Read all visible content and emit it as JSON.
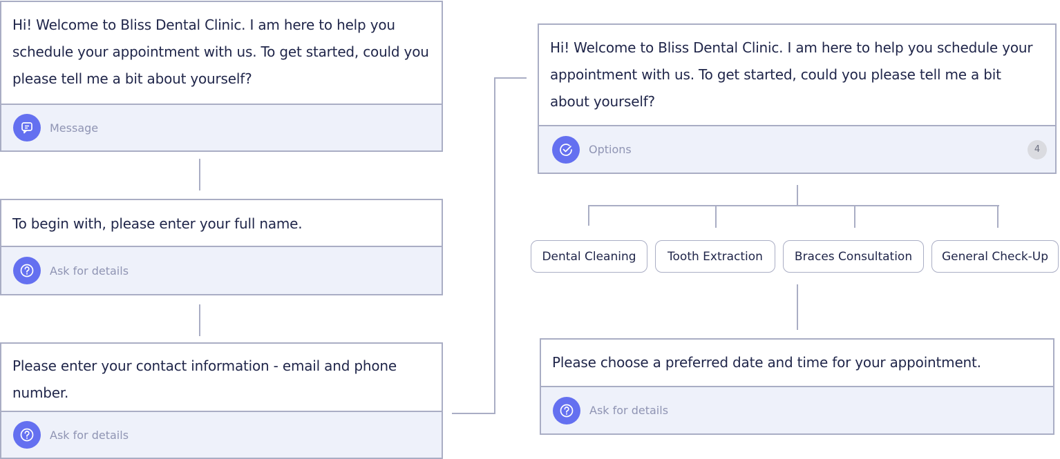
{
  "nodes": {
    "welcome_left": {
      "text": "Hi! Welcome to Bliss Dental Clinic. I am here to help you schedule your appointment with us. To get started, could you please tell me a bit about yourself?",
      "footer_label": "Message"
    },
    "full_name": {
      "text": "To begin with, please enter your full name.",
      "footer_label": "Ask for details"
    },
    "contact": {
      "text": "Please enter your contact information - email and phone number.",
      "footer_label": "Ask for details"
    },
    "welcome_right": {
      "text": "Hi! Welcome to Bliss Dental Clinic. I am here to help you schedule your appointment with us. To get started, could you please tell me a bit about yourself?",
      "footer_label": "Options",
      "count": "4"
    },
    "date_time": {
      "text": "Please choose a preferred date and time for your appointment.",
      "footer_label": "Ask for details"
    }
  },
  "options": [
    {
      "label": "Dental Cleaning"
    },
    {
      "label": "Tooth Extraction"
    },
    {
      "label": "Braces Consultation"
    },
    {
      "label": "General Check-Up"
    }
  ],
  "icons": {
    "message": "chat-bubble-icon",
    "ask_for_details": "question-circle-icon",
    "options": "check-circle-icon"
  },
  "colors": {
    "accent": "#6470f0",
    "border": "#a9adc4",
    "footer_bg": "#eef1fa",
    "text": "#20264a",
    "muted": "#8f94b3"
  }
}
